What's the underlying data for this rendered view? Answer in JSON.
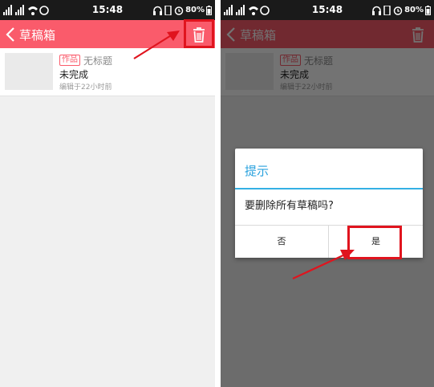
{
  "status_bar": {
    "time": "15:48",
    "battery": "80%"
  },
  "header": {
    "title": "草稿箱"
  },
  "draft_item": {
    "tag": "作品",
    "title": "无标题",
    "status": "未完成",
    "meta": "编辑于22小时前"
  },
  "dialog": {
    "title": "提示",
    "message": "要删除所有草稿吗?",
    "cancel_label": "否",
    "confirm_label": "是"
  },
  "icons": {
    "back": "chevron-left-icon",
    "delete": "trash-icon"
  },
  "colors": {
    "accent": "#fa5b6b",
    "dialog_title": "#2aa2de",
    "annotation": "#e0141e"
  }
}
